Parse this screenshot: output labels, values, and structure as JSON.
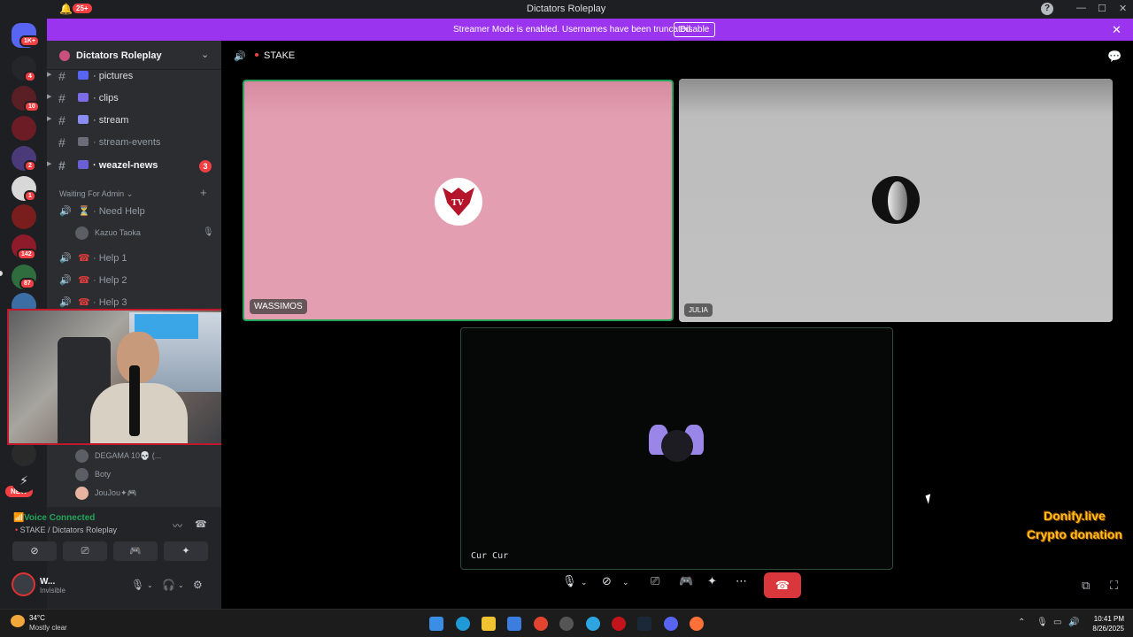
{
  "titlebar": {
    "title": "Dictators Roleplay",
    "notifications": "25+"
  },
  "banner": {
    "message": "Streamer Mode is enabled. Usernames have been truncated.",
    "disable_label": "Disable",
    "color": "#9b34ef"
  },
  "servers": [
    {
      "badge": "1K+"
    },
    {
      "badge": "4"
    },
    {
      "badge": "10"
    },
    {
      "badge": ""
    },
    {
      "badge": "2"
    },
    {
      "badge": "1"
    },
    {
      "badge": ""
    },
    {
      "badge": "142"
    },
    {
      "badge": "87"
    },
    {
      "badge": ""
    },
    {
      "badge": ""
    }
  ],
  "new_label": "NEW",
  "guild": {
    "name": "Dictators Roleplay"
  },
  "text_channels": [
    {
      "label": "pictures",
      "emoji_color": "#5865f2"
    },
    {
      "label": "clips",
      "emoji_color": "#7b6de8"
    },
    {
      "label": "stream",
      "emoji_color": "#8a8cf0"
    },
    {
      "label": "stream-events",
      "emoji_color": "#8a8cf0",
      "muted": true
    },
    {
      "label": "weazel-news",
      "emoji_color": "#6b5fd6",
      "badge": "3"
    }
  ],
  "category": {
    "label": "Waiting For Admin"
  },
  "voice_channels": [
    {
      "label": "Need Help",
      "emoji": "⏳"
    },
    {
      "label": "Help 1",
      "emoji": "📞"
    },
    {
      "label": "Help 2",
      "emoji": "📞"
    },
    {
      "label": "Help 3",
      "emoji": "📞"
    }
  ],
  "members_top": [
    {
      "name": "Kazuo Taoka"
    }
  ],
  "members_bottom": [
    {
      "name": "DEGAMA 10💀 (..."
    },
    {
      "name": "Boty"
    },
    {
      "name": "JouJou✦🎮"
    }
  ],
  "voice_panel": {
    "title": "Voice Connected",
    "subtitle": "STAKE / Dictators Roleplay"
  },
  "user": {
    "name": "W...",
    "status": "Invisible"
  },
  "stage": {
    "channel": "STAKE",
    "tiles": [
      {
        "name": "WASSIMOS",
        "speaking": true
      },
      {
        "name": "JULIA",
        "speaking": false
      },
      {
        "name": "Cur Cur",
        "speaking": false
      }
    ]
  },
  "overlay": {
    "line1": "Donify.live",
    "line2": "Crypto donation",
    "color": "#ffc21a"
  },
  "taskbar": {
    "temperature": "34°C",
    "weather": "Mostly clear",
    "time": "10:41 PM",
    "date": "8/26/2025"
  }
}
